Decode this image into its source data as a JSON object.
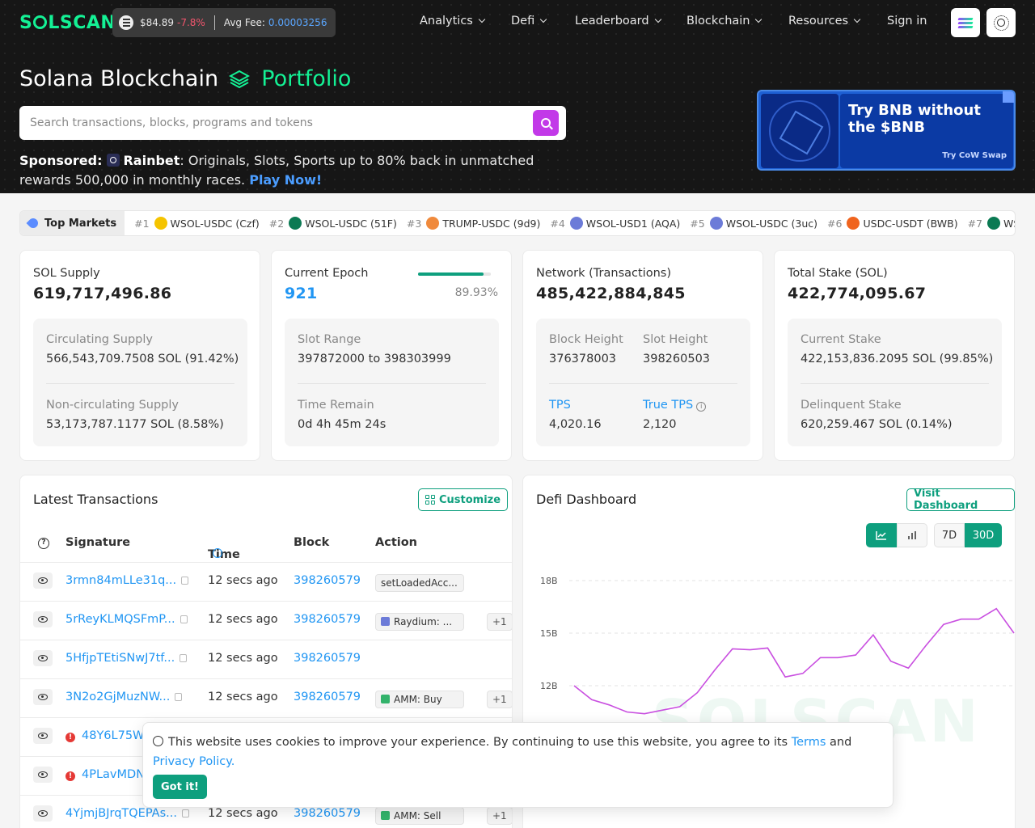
{
  "header": {
    "logo_text": "SOLSCAN",
    "sol_price": "$84.89",
    "sol_change": "-7.8%",
    "avg_fee_label": "Avg Fee:",
    "avg_fee_value": "0.00003256",
    "nav": [
      "Analytics",
      "Defi",
      "Leaderboard",
      "Blockchain",
      "Resources"
    ],
    "sign_in": "Sign in"
  },
  "hero": {
    "title_main": "Solana Blockchain",
    "title_accent": "Portfolio",
    "search_placeholder": "Search transactions, blocks, programs and tokens",
    "sponsored_label": "Sponsored:",
    "sponsor_name": "Rainbet",
    "sponsor_text": ": Originals, Slots, Sports up to 80% back in unmatched rewards 500,000 in monthly races. ",
    "sponsor_cta": "Play Now!",
    "ad_title": "Try BNB without the $BNB",
    "ad_sub": "Try CoW Swap"
  },
  "markets": {
    "label": "Top Markets",
    "items": [
      {
        "rank": "#1",
        "pair": "WSOL-USDC (Czf)",
        "color": "#f5c400"
      },
      {
        "rank": "#2",
        "pair": "WSOL-USDC (51F)",
        "color": "#0b7a53"
      },
      {
        "rank": "#3",
        "pair": "TRUMP-USDC (9d9)",
        "color": "#f08a3c"
      },
      {
        "rank": "#4",
        "pair": "WSOL-USD1 (AQA)",
        "color": "#6c7bd8"
      },
      {
        "rank": "#5",
        "pair": "WSOL-USDC (3uc)",
        "color": "#6c7bd8"
      },
      {
        "rank": "#6",
        "pair": "USDC-USDT (BWB)",
        "color": "#f0641e"
      },
      {
        "rank": "#7",
        "pair": "WSOL-USDC",
        "color": "#0b7a53"
      }
    ]
  },
  "stats": {
    "supply": {
      "label": "SOL Supply",
      "value": "619,717,496.86",
      "k1": "Circulating Supply",
      "v1": "566,543,709.7508 SOL (91.42%)",
      "k2": "Non-circulating Supply",
      "v2": "53,173,787.1177 SOL (8.58%)"
    },
    "epoch": {
      "label": "Current Epoch",
      "value": "921",
      "progress_pct": 89.93,
      "progress_text": "89.93%",
      "k1": "Slot Range",
      "v1": "397872000 to 398303999",
      "k2": "Time Remain",
      "v2": "0d 4h 45m 24s"
    },
    "network": {
      "label": "Network (Transactions)",
      "value": "485,422,884,845",
      "block_height_label": "Block Height",
      "block_height": "376378003",
      "slot_height_label": "Slot Height",
      "slot_height": "398260503",
      "tps_label": "TPS",
      "tps": "4,020.16",
      "true_tps_label": "True TPS",
      "true_tps": "2,120"
    },
    "stake": {
      "label": "Total Stake (SOL)",
      "value": "422,774,095.67",
      "k1": "Current Stake",
      "v1": "422,153,836.2095 SOL (99.85%)",
      "k2": "Delinquent Stake",
      "v2": "620,259.467 SOL (0.14%)"
    }
  },
  "transactions": {
    "title": "Latest Transactions",
    "customize": "Customize",
    "columns": {
      "signature": "Signature",
      "time": "Time",
      "block": "Block",
      "action": "Action"
    },
    "rows": [
      {
        "sig": "3rmn84mLLe31q...",
        "time": "12 secs ago",
        "block": "398260579",
        "action": "setLoadedAcc...",
        "plus": "",
        "err": false
      },
      {
        "sig": "5rReyKLMQSFmP...",
        "time": "12 secs ago",
        "block": "398260579",
        "action": "Raydium: ...",
        "plus": "+1",
        "err": false
      },
      {
        "sig": "5HfjpTEtiSNwJ7tf...",
        "time": "12 secs ago",
        "block": "398260579",
        "action": "",
        "plus": "",
        "err": false
      },
      {
        "sig": "3N2o2GjMuzNW...",
        "time": "12 secs ago",
        "block": "398260579",
        "action": "AMM: Buy",
        "plus": "+1",
        "err": false
      },
      {
        "sig": "48Y6L75W",
        "time": "",
        "block": "",
        "action": "",
        "plus": "",
        "err": true
      },
      {
        "sig": "4PLavMDN",
        "time": "",
        "block": "",
        "action": "",
        "plus": "",
        "err": true
      },
      {
        "sig": "4YjmjBJrqTQEPAs...",
        "time": "12 secs ago",
        "block": "398260579",
        "action": "AMM: Sell",
        "plus": "+1",
        "err": false
      }
    ]
  },
  "defi": {
    "title": "Defi Dashboard",
    "visit": "Visit Dashboard",
    "range_7d": "7D",
    "range_30d": "30D",
    "watermark": "SOLSCAN"
  },
  "chart_data": {
    "type": "line",
    "y_ticks": [
      "18B",
      "15B",
      "12B"
    ],
    "ylim_visible": [
      10.5,
      18
    ],
    "unit": "B",
    "x": [
      1,
      2,
      3,
      4,
      5,
      6,
      7,
      8,
      9,
      10,
      11,
      12,
      13,
      14,
      15,
      16,
      17,
      18,
      19,
      20,
      21,
      22,
      23,
      24,
      25,
      26
    ],
    "values": [
      12.0,
      11.2,
      10.9,
      10.5,
      10.4,
      10.6,
      10.8,
      11.6,
      12.9,
      14.1,
      14.05,
      14.15,
      12.5,
      12.7,
      13.6,
      13.6,
      13.75,
      14.9,
      13.4,
      13.0,
      14.3,
      15.5,
      15.8,
      15.8,
      16.4,
      15.0
    ]
  },
  "cookie": {
    "text": "This website uses cookies to improve your experience. By continuing to use this website, you agree to its ",
    "terms": "Terms",
    "and": " and ",
    "privacy": "Privacy Policy.",
    "button": "Got it!"
  }
}
